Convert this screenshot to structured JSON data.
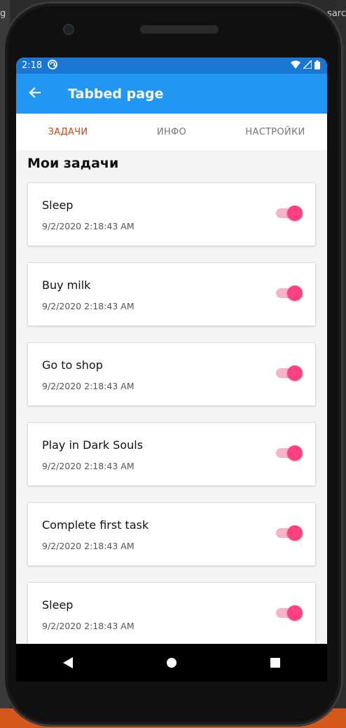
{
  "background": {
    "left_edge_text": "g",
    "right_edge_text": "sarc"
  },
  "status_bar": {
    "time": "2:18",
    "icons": [
      "sync-icon",
      "wifi-icon",
      "signal-icon",
      "battery-icon"
    ]
  },
  "app_bar": {
    "title": "Tabbed page",
    "back_icon": "arrow-left-icon"
  },
  "tabs": [
    {
      "label": "ЗАДАЧИ",
      "active": true
    },
    {
      "label": "ИНФО",
      "active": false
    },
    {
      "label": "НАСТРОЙКИ",
      "active": false
    }
  ],
  "section_title": "Мои задачи",
  "tasks": [
    {
      "title": "Sleep",
      "date": "9/2/2020 2:18:43 AM",
      "done": true
    },
    {
      "title": "Buy milk",
      "date": "9/2/2020 2:18:43 AM",
      "done": true
    },
    {
      "title": "Go to shop",
      "date": "9/2/2020 2:18:43 AM",
      "done": true
    },
    {
      "title": "Play in Dark Souls",
      "date": "9/2/2020 2:18:43 AM",
      "done": true
    },
    {
      "title": "Complete first task",
      "date": "9/2/2020 2:18:43 AM",
      "done": true
    },
    {
      "title": "Sleep",
      "date": "9/2/2020 2:18:43 AM",
      "done": true
    }
  ],
  "colors": {
    "status_bar": "#1976d2",
    "app_bar": "#2196f3",
    "active_tab": "#d1451b",
    "switch_thumb": "#ff4081",
    "switch_track": "#f8b4c6"
  },
  "nav_bar": {
    "buttons": [
      "nav-back-icon",
      "nav-home-icon",
      "nav-recent-icon"
    ]
  }
}
